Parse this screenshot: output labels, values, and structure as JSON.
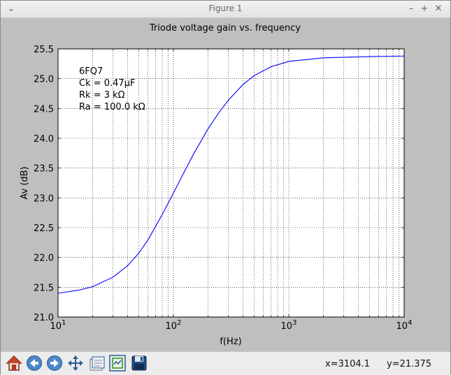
{
  "window": {
    "title": "Figure 1",
    "controls": {
      "collapse": "⌄",
      "minimize": "–",
      "maximize": "+",
      "close": "✕"
    }
  },
  "toolbar": {
    "tools": [
      "home-icon",
      "back-icon",
      "forward-icon",
      "pan-icon",
      "configure-subplots-icon",
      "zoom-icon",
      "save-icon"
    ],
    "x_readout": "x=3104.1",
    "y_readout": "y=21.375"
  },
  "annotation": {
    "line1": "6FQ7",
    "line2": "Ck = 0.47μF",
    "line3": "Rk = 3 kΩ",
    "line4": "Ra = 100.0 kΩ"
  },
  "colors": {
    "line": "#0000ff",
    "plot_bg": "#ffffff",
    "figure_bg": "#bfbfbf"
  },
  "chart_data": {
    "type": "line",
    "title": "Triode voltage gain vs. frequency",
    "xlabel": "f(Hz)",
    "ylabel": "Av (dB)",
    "xscale": "log",
    "xlim": [
      10,
      10000
    ],
    "ylim": [
      21.0,
      25.5
    ],
    "grid": true,
    "xticks": [
      {
        "value": 10,
        "base": "10",
        "exp": "1"
      },
      {
        "value": 100,
        "base": "10",
        "exp": "2"
      },
      {
        "value": 1000,
        "base": "10",
        "exp": "3"
      },
      {
        "value": 10000,
        "base": "10",
        "exp": "4"
      }
    ],
    "yticks": [
      "21.0",
      "21.5",
      "22.0",
      "22.5",
      "23.0",
      "23.5",
      "24.0",
      "24.5",
      "25.0",
      "25.5"
    ],
    "series": [
      {
        "x": [
          10,
          15,
          20,
          30,
          40,
          50,
          60,
          80,
          100,
          120,
          150,
          200,
          250,
          300,
          400,
          500,
          700,
          1000,
          2000,
          5000,
          10000
        ],
        "y": [
          21.4,
          21.45,
          21.51,
          21.67,
          21.86,
          22.07,
          22.29,
          22.72,
          23.08,
          23.38,
          23.74,
          24.16,
          24.44,
          24.64,
          24.9,
          25.05,
          25.2,
          25.29,
          25.35,
          25.37,
          25.38
        ]
      }
    ]
  }
}
